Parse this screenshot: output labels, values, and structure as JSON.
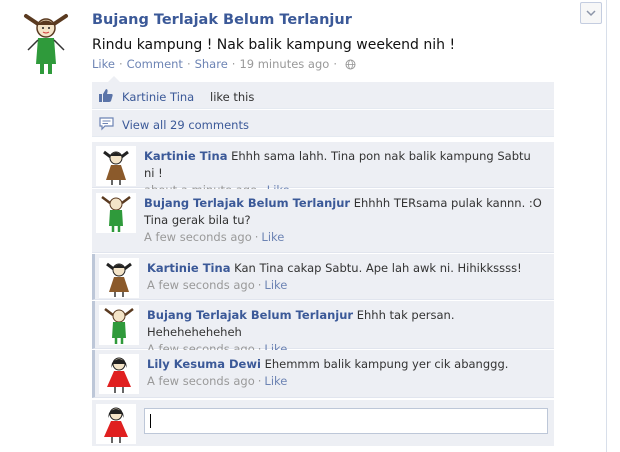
{
  "post": {
    "author": "Bujang Terlajak Belum Terlanjur",
    "text": "Rindu kampung ! Nak balik kampung weekend nih !",
    "actions": {
      "like": "Like",
      "comment": "Comment",
      "share": "Share"
    },
    "timestamp": "19 minutes ago"
  },
  "likes": {
    "name": "Kartinie Tina",
    "suffix": "like this"
  },
  "view_all": "View all 29 comments",
  "comments": [
    {
      "author": "Kartinie Tina",
      "text": "Ehhh sama lahh. Tina pon nak balik kampung Sabtu ni !",
      "time": "about a minute ago",
      "like": "Like"
    },
    {
      "author": "Bujang Terlajak Belum Terlanjur",
      "text": "Ehhhh TERsama pulak kannn. :O Tina gerak bila tu?",
      "time": "A few seconds ago",
      "like": "Like"
    },
    {
      "author": "Kartinie Tina",
      "text": " Kan Tina cakap Sabtu. Ape lah awk ni. Hihikkssss!",
      "time": "A few seconds ago",
      "like": "Like"
    },
    {
      "author": "Bujang Terlajak Belum Terlanjur",
      "text": "Ehhh tak persan. Heheheheheheh",
      "time": "A few seconds ago",
      "like": "Like"
    },
    {
      "author": "Lily Kesuma Dewi",
      "text": "Ehemmm balik kampung yer cik abanggg.",
      "time": "A few seconds ago",
      "like": "Like"
    }
  ],
  "reply": {
    "value": "",
    "placeholder": ""
  },
  "icons": {
    "menu": "chevron-down-icon",
    "privacy": "globe-icon",
    "like": "thumbs-up-icon",
    "comments": "comment-bubble-icon"
  },
  "colors": {
    "link": "#3b5998",
    "meta": "#999999",
    "feedback_bg": "#edeff4"
  }
}
